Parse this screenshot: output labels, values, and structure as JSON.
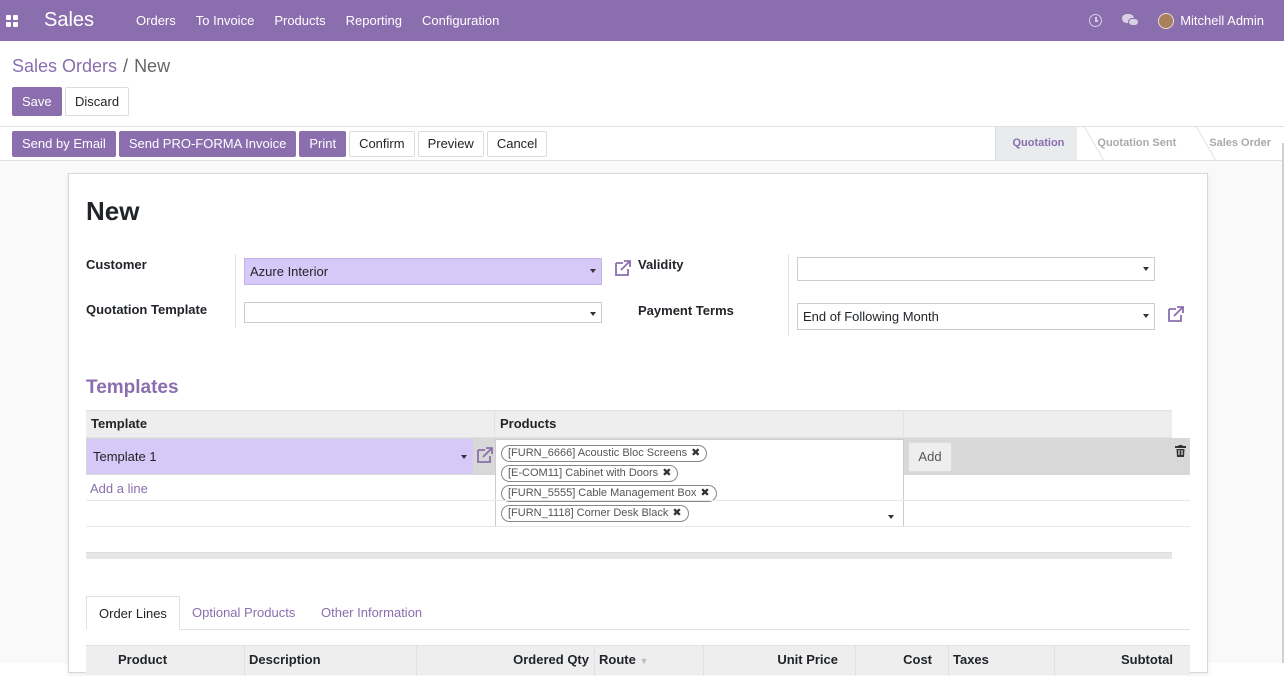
{
  "navbar": {
    "app_name": "Sales",
    "menu": [
      "Orders",
      "To Invoice",
      "Products",
      "Reporting",
      "Configuration"
    ],
    "user": "Mitchell Admin",
    "icons": [
      "apps-icon",
      "clock-icon",
      "chat-icon"
    ]
  },
  "breadcrumb": {
    "parent": "Sales Orders",
    "separator": "/",
    "current": "New"
  },
  "actions": {
    "save": "Save",
    "discard": "Discard"
  },
  "status_buttons": [
    "Send by Email",
    "Send PRO-FORMA Invoice",
    "Print",
    "Confirm",
    "Preview",
    "Cancel"
  ],
  "stages": {
    "items": [
      "Quotation",
      "Quotation Sent",
      "Sales Order"
    ],
    "active": "Quotation"
  },
  "form": {
    "title": "New",
    "customer_label": "Customer",
    "customer_value": "Azure Interior",
    "template_label": "Quotation Template",
    "template_value": "",
    "validity_label": "Validity",
    "validity_value": "",
    "payment_terms_label": "Payment Terms",
    "payment_terms_value": "End of Following Month"
  },
  "templates": {
    "title": "Templates",
    "col_template": "Template",
    "col_products": "Products",
    "row_template": "Template 1",
    "products": [
      "[FURN_6666] Acoustic Bloc Screens",
      "[E-COM11] Cabinet with Doors",
      "[FURN_5555] Cable Management Box",
      "[FURN_1118] Corner Desk Black"
    ],
    "add_button": "Add",
    "add_line": "Add a line"
  },
  "tabs": {
    "items": [
      "Order Lines",
      "Optional Products",
      "Other Information"
    ],
    "active": "Order Lines"
  },
  "order_lines": {
    "columns": [
      "Product",
      "Description",
      "Ordered Qty",
      "Route",
      "Unit Price",
      "Cost",
      "Taxes",
      "Subtotal"
    ]
  },
  "colors": {
    "brand": "#8a6eae",
    "highlight_field": "#d6c8f7"
  }
}
